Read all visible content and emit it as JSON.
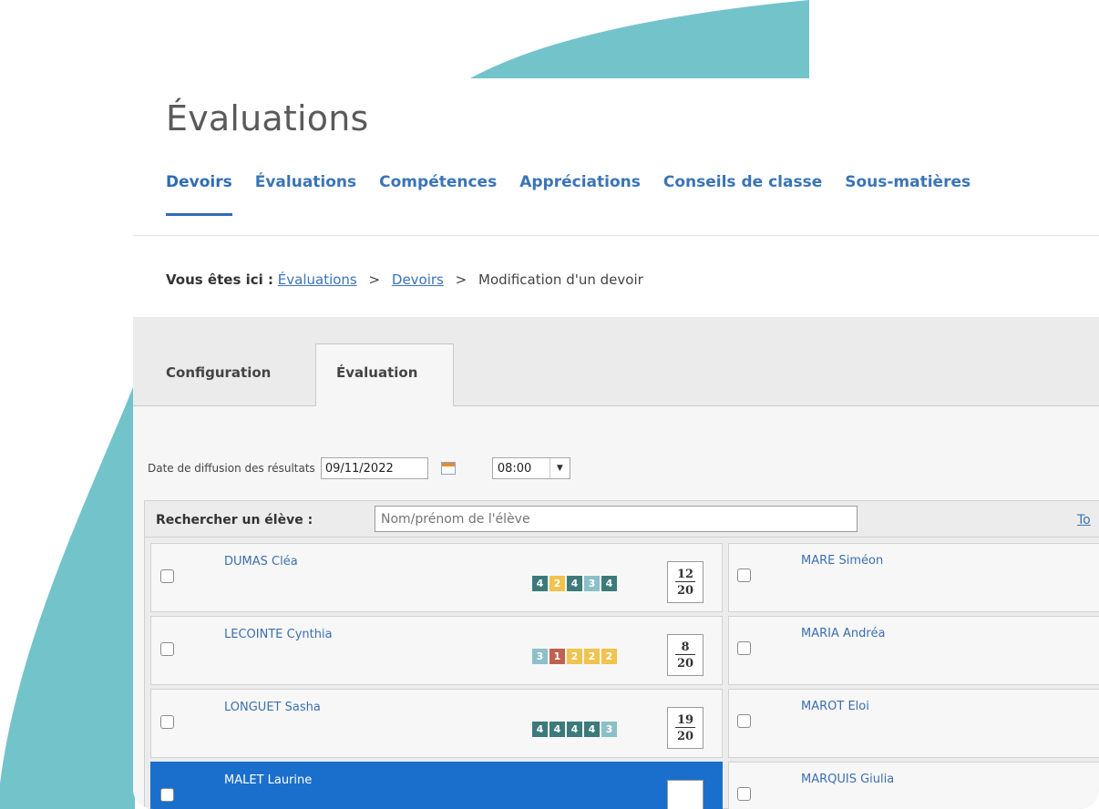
{
  "page": {
    "title": "Évaluations",
    "nav_tabs": [
      "Devoirs",
      "Évaluations",
      "Compétences",
      "Appréciations",
      "Conseils de classe",
      "Sous-matières"
    ],
    "active_nav": "Devoirs"
  },
  "breadcrumb": {
    "prefix": "Vous êtes ici :",
    "items": [
      "Évaluations",
      "Devoirs"
    ],
    "current": "Modification d'un devoir",
    "separator": ">"
  },
  "sub_tabs": {
    "configuration": "Configuration",
    "evaluation": "Évaluation"
  },
  "diffusion": {
    "label": "Date de diffusion des résultats",
    "date": "09/11/2022",
    "time": "08:00"
  },
  "search": {
    "label": "Rechercher un élève :",
    "placeholder": "Nom/prénom de l'élève",
    "link": "To"
  },
  "colors": {
    "level_4": "#3d7a7a",
    "level_3": "#8cc0c8",
    "level_2": "#f0c34e",
    "level_1": "#c0614f",
    "accent": "#2f6cb5",
    "teal": "#73c3cb"
  },
  "students_left": [
    {
      "name": "DUMAS Cléa",
      "levels": [
        "4",
        "2",
        "4",
        "3",
        "4"
      ],
      "grade": "12",
      "out_of": "20"
    },
    {
      "name": "LECOINTE Cynthia",
      "levels": [
        "3",
        "1",
        "2",
        "2",
        "2"
      ],
      "grade": "8",
      "out_of": "20"
    },
    {
      "name": "LONGUET Sasha",
      "levels": [
        "4",
        "4",
        "4",
        "4",
        "3"
      ],
      "grade": "19",
      "out_of": "20"
    },
    {
      "name": "MALET Laurine"
    }
  ],
  "students_right": [
    {
      "name": "MARE Siméon"
    },
    {
      "name": "MARIA Andréa"
    },
    {
      "name": "MAROT Eloi"
    },
    {
      "name": "MARQUIS Giulia"
    }
  ]
}
